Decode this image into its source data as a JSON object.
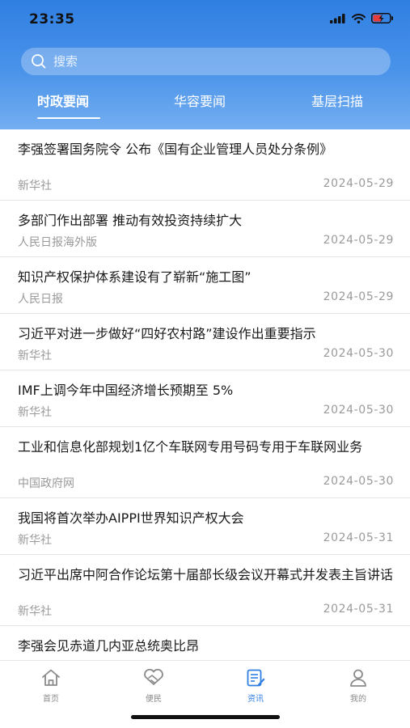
{
  "status_bar": {
    "time": "23:35"
  },
  "search": {
    "placeholder": "搜索"
  },
  "tabs": [
    {
      "label": "时政要闻",
      "active": true
    },
    {
      "label": "华容要闻",
      "active": false
    },
    {
      "label": "基层扫描",
      "active": false
    }
  ],
  "news": [
    {
      "title": "李强签署国务院令 公布《国有企业管理人员处分条例》",
      "source": "新华社",
      "date": "2024-05-29"
    },
    {
      "title": "多部门作出部署 推动有效投资持续扩大",
      "source": "人民日报海外版",
      "date": "2024-05-29"
    },
    {
      "title": "知识产权保护体系建设有了崭新“施工图”",
      "source": "人民日报",
      "date": "2024-05-29"
    },
    {
      "title": "习近平对进一步做好“四好农村路”建设作出重要指示",
      "source": "新华社",
      "date": "2024-05-30"
    },
    {
      "title": "IMF上调今年中国经济增长预期至 5%",
      "source": "新华社",
      "date": "2024-05-30"
    },
    {
      "title": "工业和信息化部规划1亿个车联网专用号码专用于车联网业务",
      "source": "中国政府网",
      "date": "2024-05-30"
    },
    {
      "title": "我国将首次举办AIPPI世界知识产权大会",
      "source": "新华社",
      "date": "2024-05-31"
    },
    {
      "title": "习近平出席中阿合作论坛第十届部长级会议开幕式并发表主旨讲话",
      "source": "新华社",
      "date": "2024-05-31"
    },
    {
      "title": "李强会见赤道几内亚总统奥比昂",
      "source": "",
      "date": ""
    }
  ],
  "bottom_nav": [
    {
      "label": "首页",
      "icon": "home-icon",
      "active": false
    },
    {
      "label": "便民",
      "icon": "handshake-icon",
      "active": false
    },
    {
      "label": "资讯",
      "icon": "news-icon",
      "active": true
    },
    {
      "label": "我的",
      "icon": "user-icon",
      "active": false
    }
  ],
  "colors": {
    "primary": "#2f7fe2",
    "text": "#1a1a1a",
    "meta": "#9a9a9a",
    "divider": "#e4e4e4"
  }
}
